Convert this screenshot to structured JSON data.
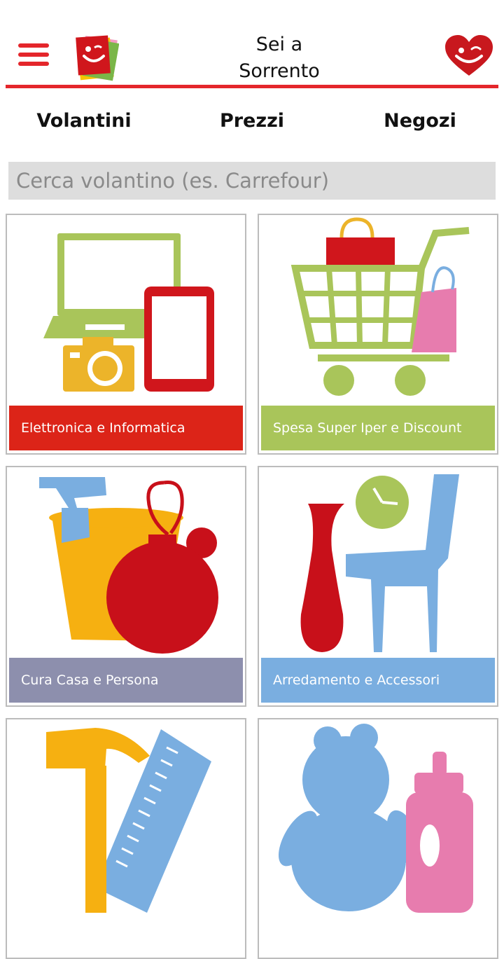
{
  "header": {
    "title_line1": "Sei a",
    "title_line2": "Sorrento"
  },
  "tabs": [
    {
      "label": "Volantini"
    },
    {
      "label": "Prezzi"
    },
    {
      "label": "Negozi"
    }
  ],
  "search": {
    "placeholder": "Cerca volantino (es. Carrefour)"
  },
  "categories": [
    {
      "label": "Elettronica e Informatica",
      "color": "#dc2418"
    },
    {
      "label": "Spesa Super Iper e Discount",
      "color": "#a9c55a"
    },
    {
      "label": "Cura Casa e Persona",
      "color": "#8d8fad"
    },
    {
      "label": "Arredamento e Accessori",
      "color": "#7aaee0"
    },
    {
      "label": "",
      "color": "#ffffff"
    },
    {
      "label": "",
      "color": "#ffffff"
    }
  ],
  "colors": {
    "accent": "#e4262b"
  }
}
